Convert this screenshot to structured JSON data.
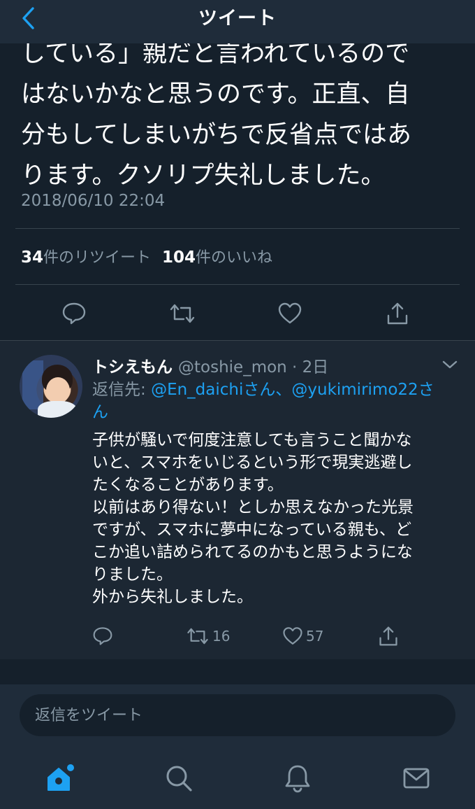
{
  "nav": {
    "title": "ツイート"
  },
  "tweet": {
    "text": "している」親だと言われているので\nはないかなと思うのです。正直、自\n分もしてしまいがちで反省点ではあ\nります。クソリプ失礼しました。",
    "timestamp": "2018/06/10 22:04",
    "retweet_count": "34",
    "retweet_label": "件のリツイート",
    "like_count": "104",
    "like_label": "件のいいね"
  },
  "reply": {
    "name": "トシえもん",
    "handle": "@toshie_mon · 2日",
    "reply_prefix": "返信先:",
    "mention1": "@En_daichiさん",
    "separator": "、",
    "mention2": "@yukimirimo22さ",
    "mention2_cont": "ん",
    "body": "子供が騒いで何度注意しても言うこと聞かな\nいと、スマホをいじるという形で現実逃避し\nたくなることがあります。\n以前はあり得ない！としか思えなかった光景\nですが、スマホに夢中になっている親も、ど\nこか追い詰められてるのかもと思うようにな\nりました。\n外から失礼しました。",
    "retweets": "16",
    "likes": "57"
  },
  "composer": {
    "placeholder": "返信をツイート"
  },
  "colors": {
    "accent": "#1da1f2",
    "background": "#15202b",
    "muted": "#8899a6"
  },
  "icons": [
    "back-icon",
    "reply-icon",
    "retweet-icon",
    "like-icon",
    "share-icon",
    "chevron-down-icon",
    "home-icon",
    "search-icon",
    "notifications-icon",
    "messages-icon"
  ]
}
